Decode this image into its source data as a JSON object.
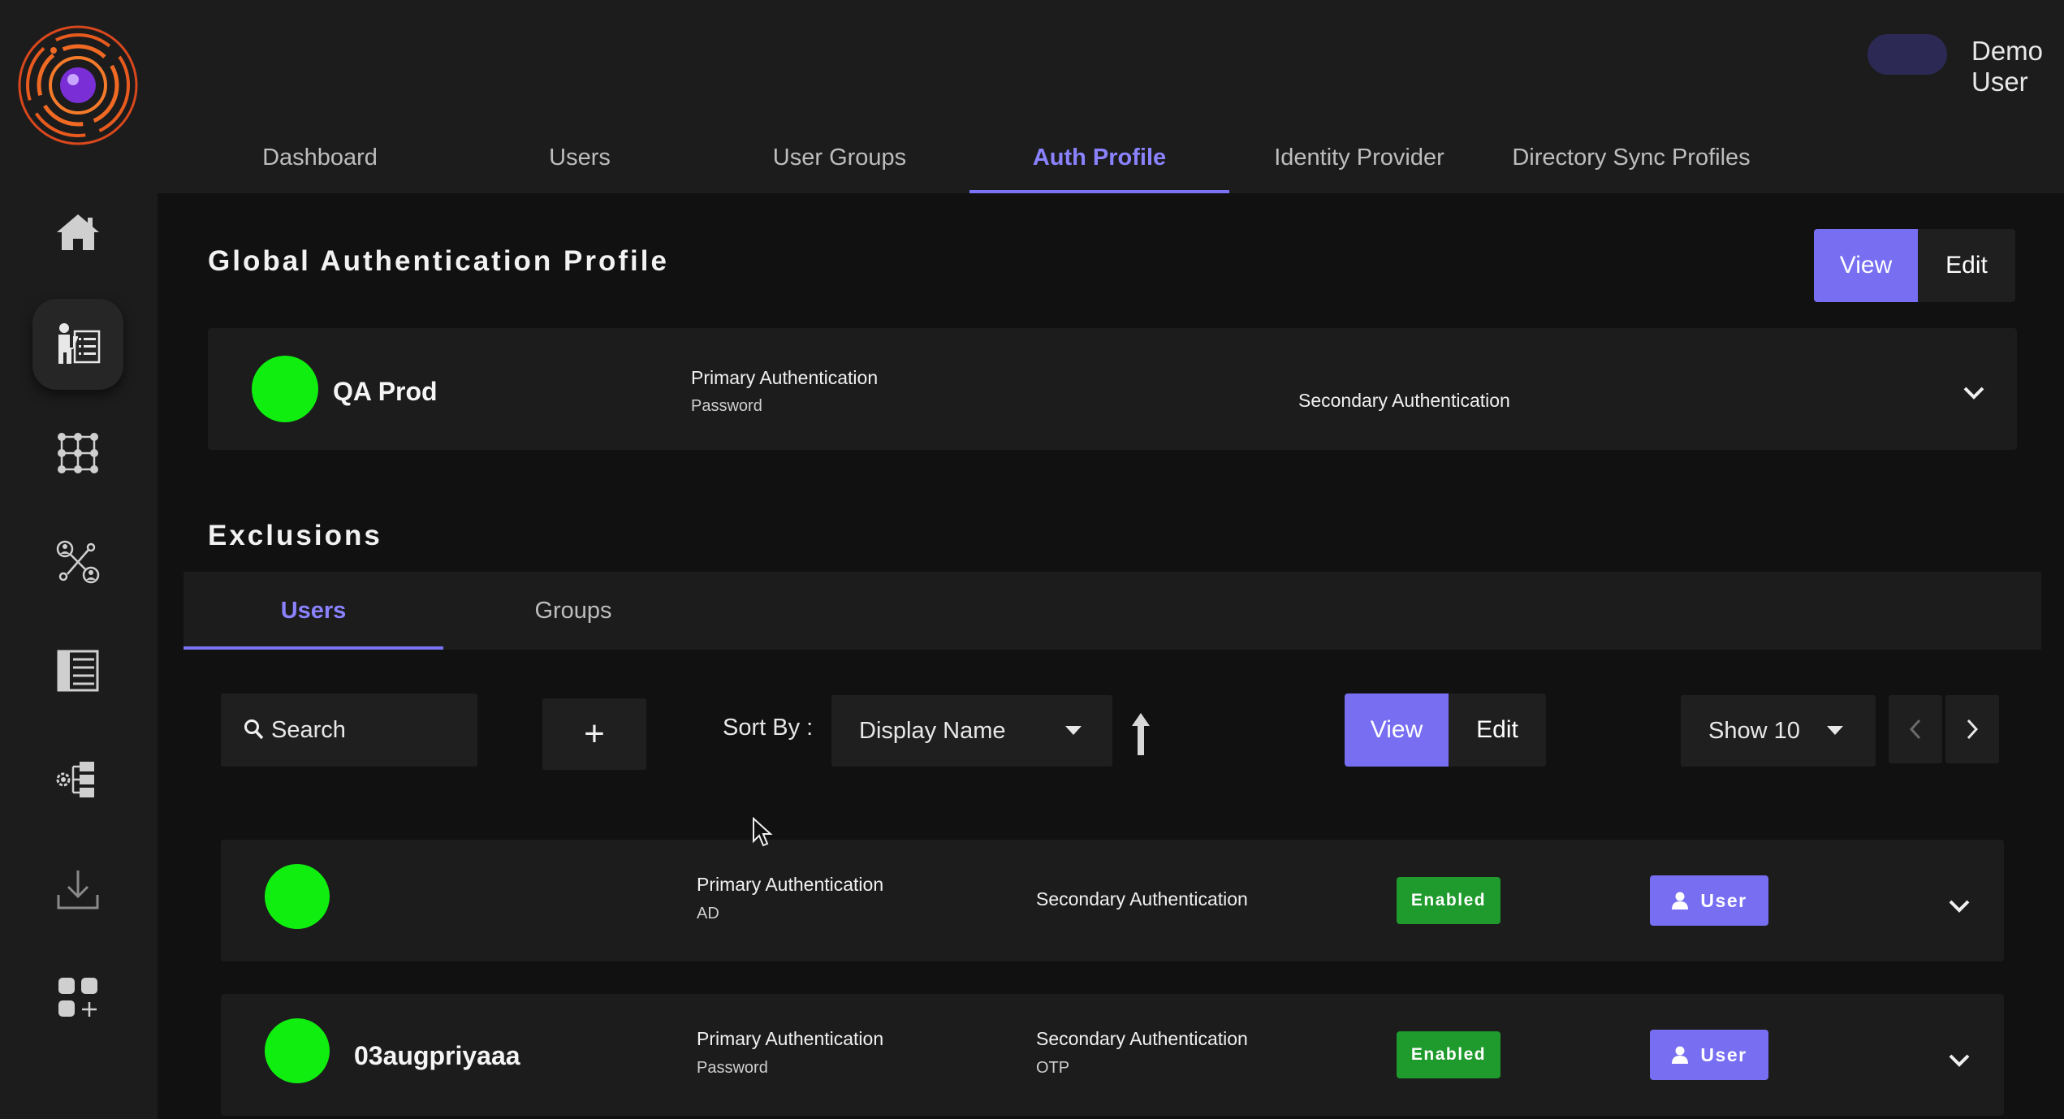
{
  "header": {
    "user_name": "Demo User"
  },
  "nav_tabs": [
    {
      "label": "Dashboard"
    },
    {
      "label": "Users"
    },
    {
      "label": "User Groups"
    },
    {
      "label": "Auth Profile",
      "active": true
    },
    {
      "label": "Identity Provider"
    },
    {
      "label": "Directory Sync Profiles"
    }
  ],
  "global_profile": {
    "title": "Global Authentication Profile",
    "view_label": "View",
    "edit_label": "Edit",
    "name": "QA Prod",
    "primary_label": "Primary Authentication",
    "primary_value": "Password",
    "secondary_label": "Secondary Authentication"
  },
  "exclusions": {
    "title": "Exclusions",
    "tabs": [
      {
        "label": "Users",
        "active": true
      },
      {
        "label": "Groups"
      }
    ],
    "search_placeholder": "Search",
    "add_label": "+",
    "sort_label": "Sort By :",
    "sort_value": "Display Name",
    "view_label": "View",
    "edit_label": "Edit",
    "show_value": "Show 10",
    "rows": [
      {
        "name": "",
        "primary_label": "Primary Authentication",
        "primary_value": "AD",
        "secondary_label": "Secondary Authentication",
        "secondary_value": "",
        "status": "Enabled",
        "type": "User"
      },
      {
        "name": "03augpriyaaa",
        "primary_label": "Primary Authentication",
        "primary_value": "Password",
        "secondary_label": "Secondary Authentication",
        "secondary_value": "OTP",
        "status": "Enabled",
        "type": "User"
      }
    ]
  },
  "colors": {
    "accent": "#776ef2",
    "status_green": "#1f9a2c",
    "dot_green": "#10ee10",
    "background": "#111111",
    "panel": "#1c1c1c"
  }
}
